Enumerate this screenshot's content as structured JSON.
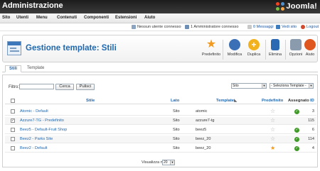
{
  "header": {
    "title": "Administrazione",
    "brand": "Joomla!"
  },
  "menu": [
    "Sito",
    "Utenti",
    "Menu",
    "Contenuti",
    "Componenti",
    "Estensioni",
    "Aiuto"
  ],
  "status": {
    "visitors": "Nessun utente connesso",
    "admins": "1 Amministratore connesso",
    "messages": "0 Messaggi",
    "view_site": "Vedi sito",
    "logout": "Logout"
  },
  "page": {
    "title": "Gestione template: Stili"
  },
  "toolbar": {
    "default": "Predefinito",
    "edit": "Modifica",
    "duplicate": "Duplica",
    "delete": "Elimina",
    "options": "Opzioni",
    "help": "Aiuto"
  },
  "tabs": [
    "Stili",
    "Template"
  ],
  "filter": {
    "label": "Filtro:",
    "value": "",
    "search_button": "Cerca",
    "clear_button": "Pulisci",
    "location_select": "Sito",
    "template_select": "- Seleziona Template -"
  },
  "table": {
    "headers": {
      "style": "Stile",
      "location": "Lato",
      "template": "Template",
      "default": "Predefinito",
      "assigned": "Assegnato",
      "id": "ID"
    },
    "rows": [
      {
        "style": "Atomic - Default",
        "location": "Sito",
        "template": "atomic",
        "default": false,
        "assigned": true,
        "id": "3",
        "checked": false
      },
      {
        "style": "Azzure7-TG - Predefinito",
        "location": "Sito",
        "template": "azzure7-tg",
        "default": false,
        "assigned": false,
        "id": "115",
        "checked": true
      },
      {
        "style": "Beez5 - Default-Fruit Shop",
        "location": "Sito",
        "template": "beez5",
        "default": false,
        "assigned": true,
        "id": "6",
        "checked": false
      },
      {
        "style": "Beez2 - Parks Site",
        "location": "Sito",
        "template": "beez_20",
        "default": false,
        "assigned": true,
        "id": "114",
        "checked": false
      },
      {
        "style": "Beez2 - Default",
        "location": "Sito",
        "template": "beez_20",
        "default": true,
        "assigned": true,
        "id": "4",
        "checked": false
      }
    ]
  },
  "pagination": {
    "label": "Visualizza n.",
    "value": "20"
  },
  "colors": {
    "accent": "#1f68b0",
    "header_bg": "#2a2a2a",
    "star_default": "#f29a1d",
    "assigned_green": "#3f9a27"
  }
}
